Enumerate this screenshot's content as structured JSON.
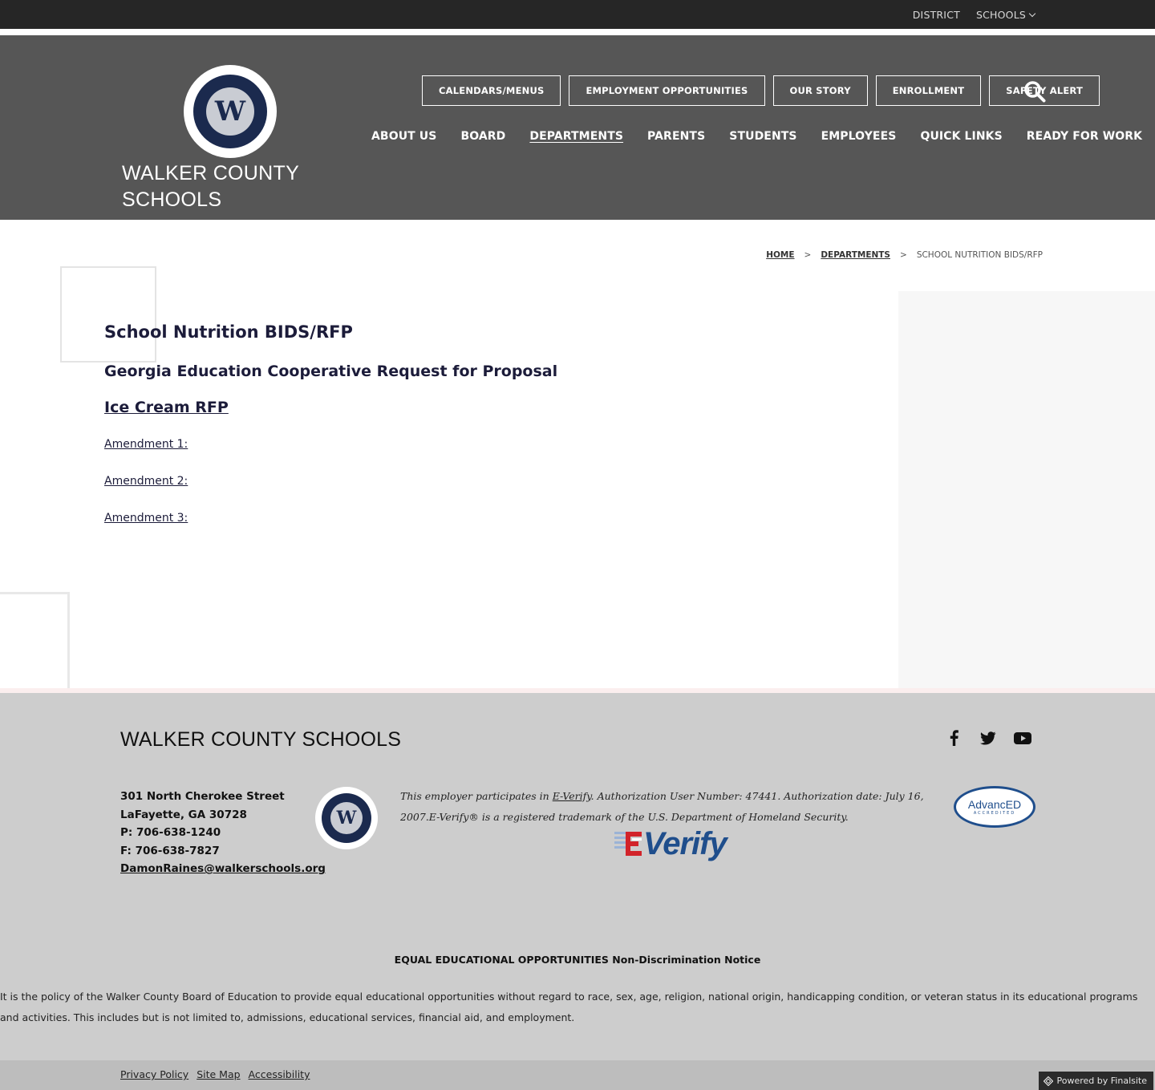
{
  "topbar": {
    "district": "DISTRICT",
    "schools": "SCHOOLS"
  },
  "header": {
    "site_name_line1": "WALKER COUNTY",
    "site_name_line2": "SCHOOLS",
    "logo_letter": "W",
    "quick_buttons": [
      "CALENDARS/MENUS",
      "EMPLOYMENT OPPORTUNITIES",
      "OUR STORY",
      "ENROLLMENT",
      "SAFETY ALERT"
    ],
    "nav": [
      "ABOUT US",
      "BOARD",
      "DEPARTMENTS",
      "PARENTS",
      "STUDENTS",
      "EMPLOYEES",
      "QUICK LINKS",
      "READY FOR WORK"
    ]
  },
  "breadcrumb": {
    "home": "HOME",
    "sep": ">",
    "departments": "DEPARTMENTS",
    "current": "SCHOOL NUTRITION BIDS/RFP"
  },
  "content": {
    "title": "School Nutrition BIDS/RFP",
    "subtitle": "Georgia Education Cooperative Request for Proposal",
    "rfp_link": "Ice Cream RFP ",
    "amendments": [
      "Amendment 1: ",
      "Amendment 2: ",
      "Amendment 3: "
    ]
  },
  "footer": {
    "title": "WALKER COUNTY SCHOOLS",
    "address_line1": "301 North Cherokee Street",
    "address_line2": "LaFayette, GA 30728",
    "phone": "P: 706-638-1240",
    "fax": "F: 706-638-7827",
    "email": "DamonRaines@walkerschools.org",
    "everify_pre": "This employer participates in ",
    "everify_link": "E-Verify",
    "everify_post": ". Authorization User Number: 47441. Authorization date: July 16, 2007.E-Verify® is a registered trademark of the U.S. Department of Homeland Security.",
    "everify_logo_text": "Verify",
    "advanced_name": "AdvancED",
    "advanced_sub": "ACCREDITED",
    "eeo_title": "EQUAL EDUCATIONAL OPPORTUNITIES Non-Discrimination Notice",
    "eeo_body": "It is the policy of the Walker County Board of Education to provide equal educational opportunities without regard to race, sex, age, religion, national origin, handicapping condition, or veteran status in its educational programs and activities.  This includes but is not limited to, admissions, educational services, financial aid, and employment."
  },
  "bottom": {
    "privacy": "Privacy Policy",
    "sitemap": "Site Map",
    "accessibility": "Accessibility",
    "powered": "Powered by Finalsite"
  }
}
